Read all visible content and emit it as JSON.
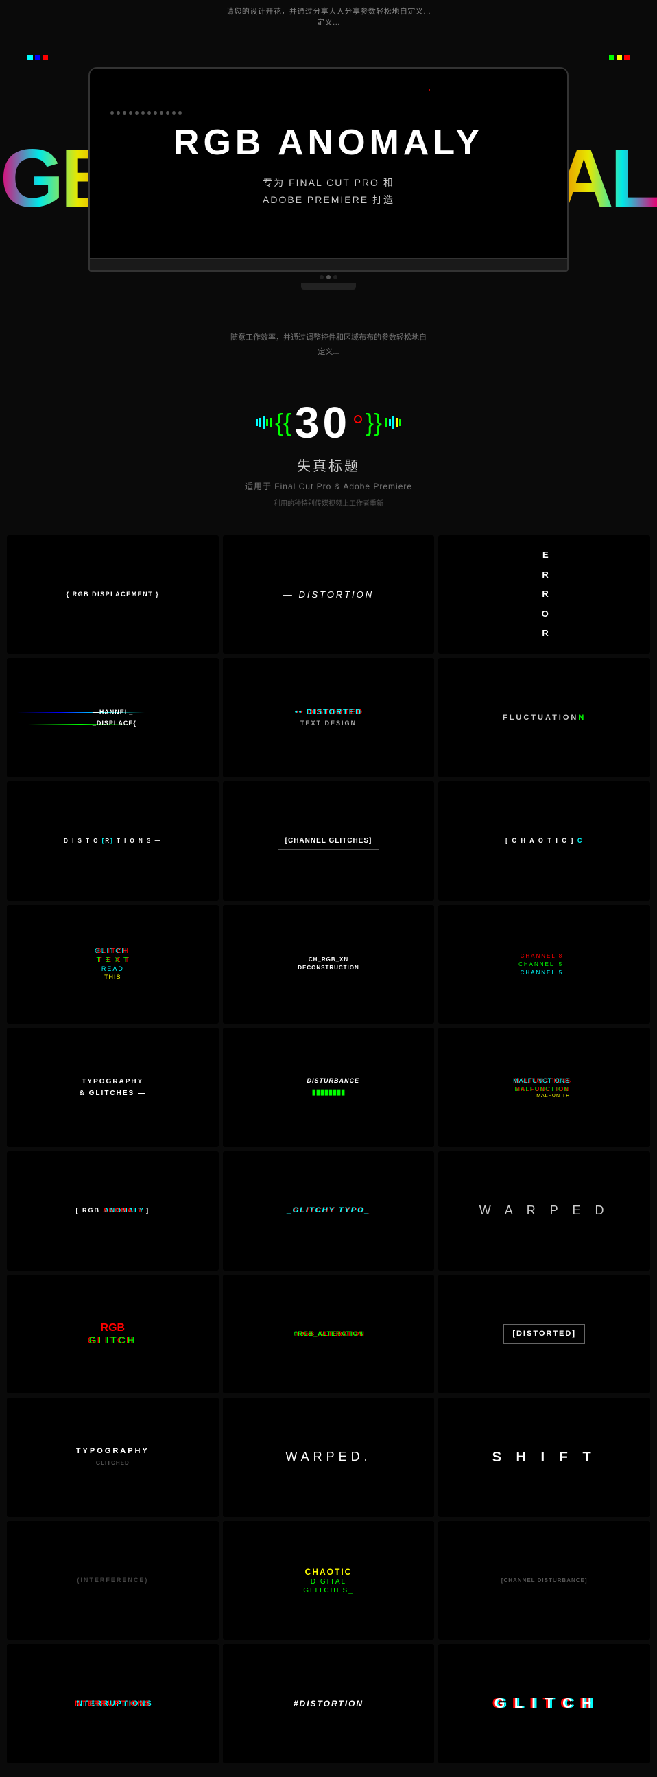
{
  "top": {
    "notice": "请您的设计开花，并通过分享大人分享参数轻松地自定义...",
    "notice2": "定义..."
  },
  "hero": {
    "title": "RGB ANOMALY",
    "side_left": "GB",
    "side_right": "AL",
    "subtitle_line1": "专为 FINAL CUT PRO 和",
    "subtitle_line2": "ADOBE PREMIERE 打造"
  },
  "description": {
    "line1": "随意工作效率，并通过调整控件和区域布布的参数轻松地自",
    "line2": "定义..."
  },
  "counter": {
    "number": "30",
    "label": "失真标题",
    "sublabel": "适用于 Final Cut Pro & Adobe Premiere",
    "desc": "利用的种特别传媒视频上工作者重新"
  },
  "grid": {
    "items": [
      {
        "id": 1,
        "text": "{ RGB DISPLACEMENT }",
        "style": "bracket",
        "color": "white"
      },
      {
        "id": 2,
        "text": "— DISTORTION",
        "style": "distortion",
        "color": "white"
      },
      {
        "id": 3,
        "text": "E\nR\nR\nO\nR",
        "style": "error",
        "color": "white"
      },
      {
        "id": 4,
        "text": "—HANNEL_\n_DISPLACE{",
        "style": "channel",
        "color": "white",
        "accent": "colorBars"
      },
      {
        "id": 5,
        "text": "•• DISTORTED\nTEXT DESIGN",
        "style": "distorted-color",
        "color": "cyan-red"
      },
      {
        "id": 6,
        "text": "FLUCTUATION",
        "style": "fluctuation",
        "color": "white"
      },
      {
        "id": 7,
        "text": "D I S T O [ R ] T I O N S —",
        "style": "spaced",
        "color": "white"
      },
      {
        "id": 8,
        "text": "[CHANNEL GLITCHES]",
        "style": "bracket-large",
        "color": "white"
      },
      {
        "id": 9,
        "text": "[ C H A O T I C ] C",
        "style": "spaced",
        "color": "white"
      },
      {
        "id": 10,
        "text": "GLITCH TEXT\nREAD THIS",
        "style": "multi-color",
        "color": "rgb"
      },
      {
        "id": 11,
        "text": "CH_RGB_XN\nDECONSTRUCTION",
        "style": "small-distort",
        "color": "white"
      },
      {
        "id": 12,
        "text": "CHANNEL 8\nCHANNEL_5\nCHANNEL 5",
        "style": "channels",
        "color": "rgb"
      },
      {
        "id": 13,
        "text": "TYPOGRAPHY\n& GLITCHES —",
        "style": "medium",
        "color": "white"
      },
      {
        "id": 14,
        "text": "— DISTURBANCE\n▮▮▮▮▮▮▮▮",
        "style": "disturbance",
        "color": "white"
      },
      {
        "id": 15,
        "text": "MALFUNCTIONS\nMALFUN TH",
        "style": "malfunction",
        "color": "rgb-multi"
      },
      {
        "id": 16,
        "text": "[ RGB ANOMALY ]",
        "style": "bracket-spaced",
        "color": "white"
      },
      {
        "id": 17,
        "text": "_GLITCHY TYPO_",
        "style": "glitchy-typo",
        "color": "white"
      },
      {
        "id": 18,
        "text": "W A R P E D",
        "style": "warped",
        "color": "white"
      },
      {
        "id": 19,
        "text": "RGB\nGLITCH",
        "style": "small-rgb",
        "color": "rgb"
      },
      {
        "id": 20,
        "text": "#RGB_ALTERATION",
        "style": "alt-color",
        "color": "green-glitch"
      },
      {
        "id": 21,
        "text": "[DISTORTED]",
        "style": "distorted-bracket",
        "color": "white"
      },
      {
        "id": 22,
        "text": "TYPOGRAPHY",
        "style": "typo",
        "color": "white"
      },
      {
        "id": 23,
        "text": "WARPED.",
        "style": "warped-dot",
        "color": "white"
      },
      {
        "id": 24,
        "text": "S H I F T",
        "style": "shift",
        "color": "white"
      },
      {
        "id": 25,
        "text": "(INTERFERENCE)",
        "style": "interference",
        "color": "dark"
      },
      {
        "id": 26,
        "text": "CHAOTIC\nDIGITAL\nGLITCHES_",
        "style": "chaotic-digital",
        "color": "yellow-green"
      },
      {
        "id": 27,
        "text": "[CHANNEL DISTURBANCE]",
        "style": "channel-dist",
        "color": "dim"
      },
      {
        "id": 28,
        "text": "NTERRUPTIONS",
        "style": "interruptions",
        "color": "rgb-shift"
      },
      {
        "id": 29,
        "text": "#DISTORTION",
        "style": "hash-dist",
        "color": "white"
      },
      {
        "id": 30,
        "text": "G L I T C H",
        "style": "glitch-large",
        "color": "rgb-big"
      }
    ]
  }
}
